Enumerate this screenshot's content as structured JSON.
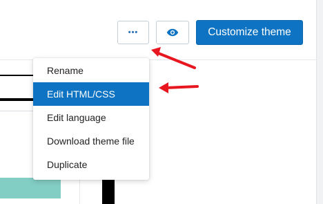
{
  "toolbar": {
    "more_icon": "more-horizontal-icon",
    "more_glyph": "•••",
    "preview_icon": "eye-icon",
    "customize_label": "Customize theme"
  },
  "dropdown": {
    "items": [
      {
        "label": "Rename",
        "active": false
      },
      {
        "label": "Edit HTML/CSS",
        "active": true
      },
      {
        "label": "Edit language",
        "active": false
      },
      {
        "label": "Download theme file",
        "active": false
      },
      {
        "label": "Duplicate",
        "active": false
      }
    ]
  },
  "annotations": {
    "arrow_color": "#e8171f"
  },
  "colors": {
    "primary": "#0d73c2",
    "teal": "#82cdc4"
  }
}
